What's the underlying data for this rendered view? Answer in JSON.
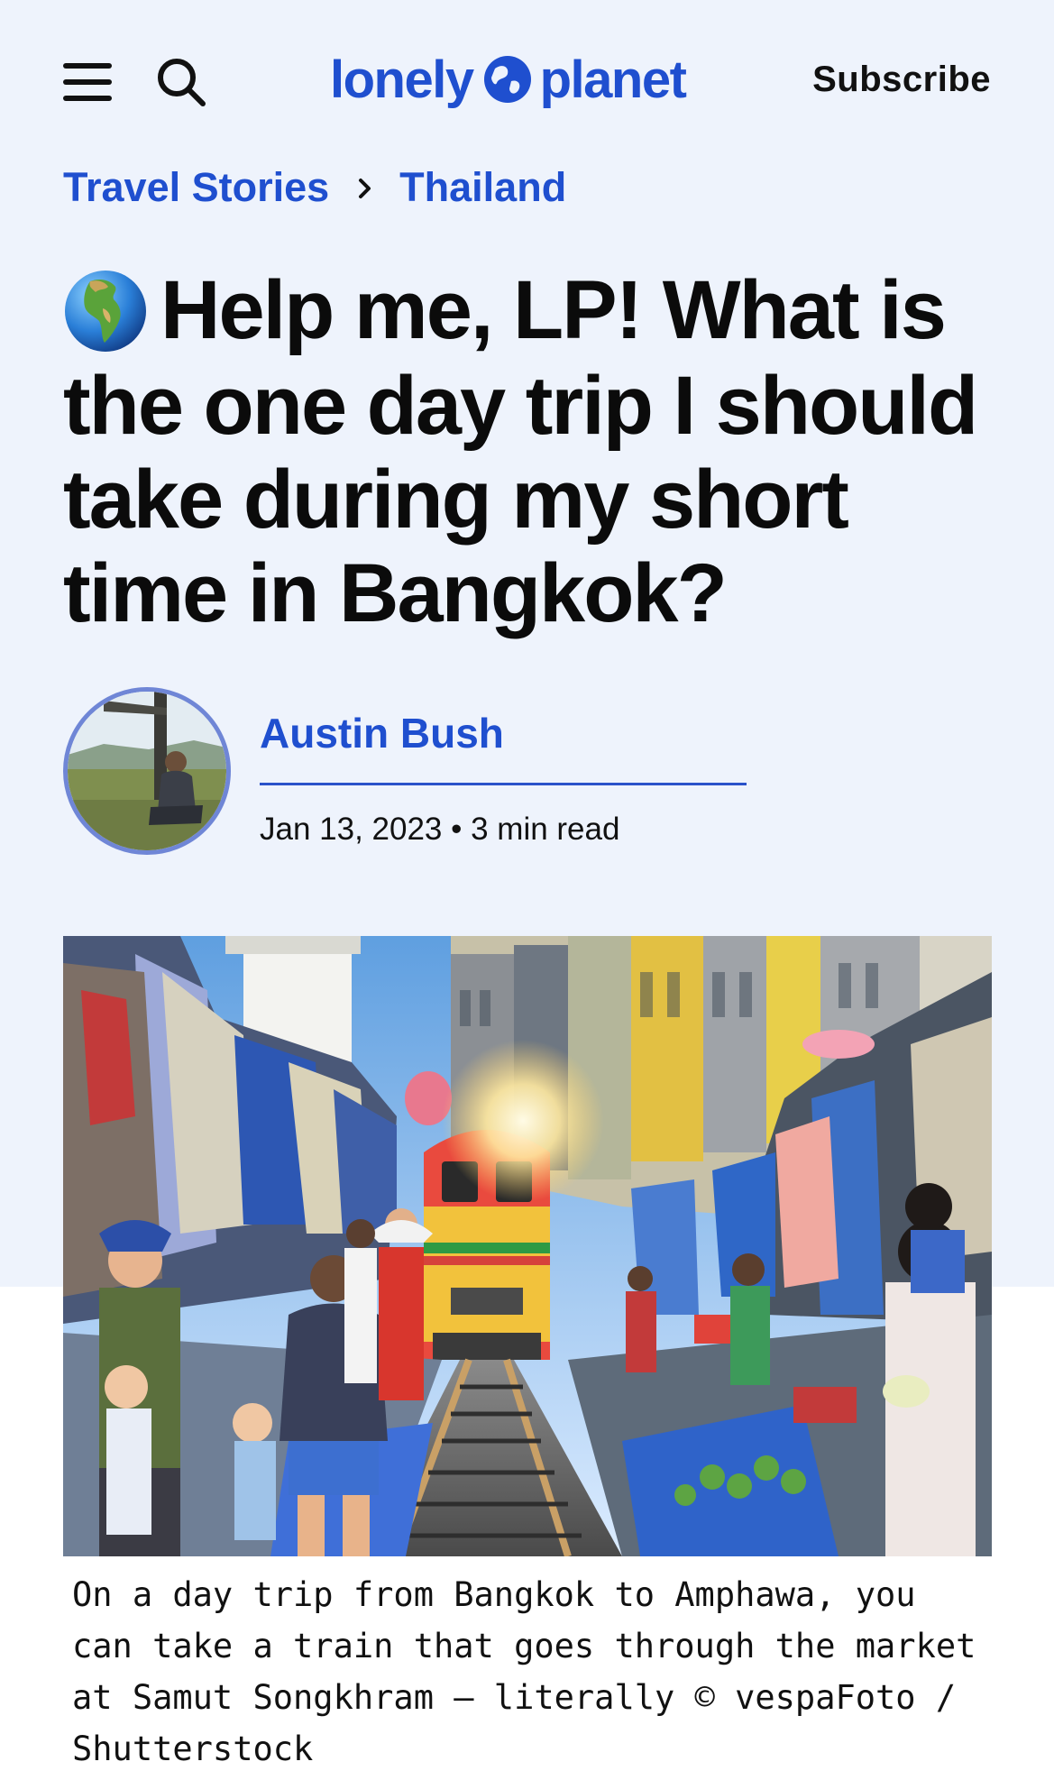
{
  "header": {
    "menu_icon": "hamburger-menu-icon",
    "search_icon": "search-icon",
    "logo": {
      "left": "lonely",
      "right": "planet",
      "icon": "globe-icon",
      "color": "#1f4fcf"
    },
    "subscribe_label": "Subscribe"
  },
  "breadcrumb": {
    "items": [
      {
        "label": "Travel Stories"
      },
      {
        "label": "Thailand"
      }
    ],
    "separator_icon": "chevron-right-icon"
  },
  "article": {
    "title_emoji": "globe-europe-africa-icon",
    "title": "Help me, LP! What is the one day trip I should take during my short time in Bangkok?",
    "author": {
      "name": "Austin Bush",
      "avatar": "author-photo"
    },
    "date": "Jan 13, 2023",
    "read_time": "3 min read",
    "meta_line": "Jan 13, 2023 • 3 min read",
    "hero_image": {
      "subject": "train passing through Maeklong railway market"
    },
    "caption": "On a day trip from Bangkok to Amphawa, you can take a train that goes through the market at Samut Songkhram – literally © vespaFoto / Shutterstock"
  },
  "colors": {
    "accent": "#1f4fcf",
    "page_bg": "#eef3fc",
    "text": "#0b0b0b"
  }
}
